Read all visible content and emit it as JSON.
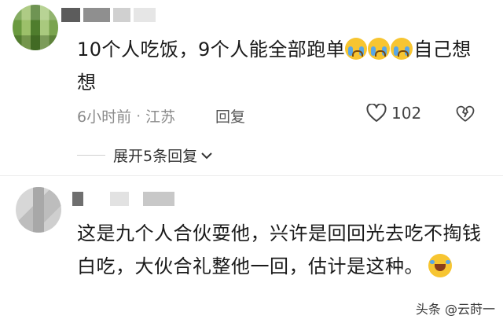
{
  "comments": [
    {
      "text_part1": "10个人吃饭，9个人能全部跑单",
      "text_part2": "自己想想",
      "emoji": [
        "crying-face-emoji",
        "crying-face-emoji",
        "crying-face-emoji"
      ],
      "time": "6小时前",
      "separator": "·",
      "location": "江苏",
      "reply_label": "回复",
      "like_count": "102",
      "expand_label": "展开5条回复"
    },
    {
      "text": "这是九个人合伙耍他，兴许是回回光去吃不掏钱白吃，大伙合礼整他一回，估计是这种。",
      "emoji": [
        "laughing-tears-emoji"
      ]
    }
  ],
  "watermark": "头条 @云莳一",
  "colors": {
    "text": "#1a1a1a",
    "meta": "#8a8a8a",
    "emoji": "#f7c531"
  }
}
